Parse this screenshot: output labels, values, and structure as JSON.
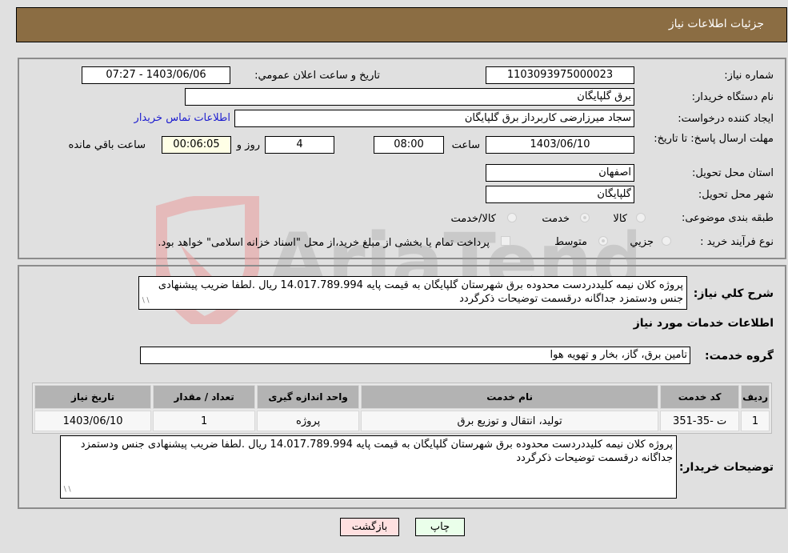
{
  "header": {
    "title": "جزئیات اطلاعات نیاز"
  },
  "form": {
    "need_number": {
      "label": "شماره نیاز:",
      "value": "1103093975000023"
    },
    "announce_datetime": {
      "label": "تاریخ و ساعت اعلان عمومي:",
      "value": "1403/06/06 - 07:27"
    },
    "buyer_org": {
      "label": "نام دستگاه خریدار:",
      "value": "برق گلپایگان"
    },
    "requester": {
      "label": "ایجاد کننده درخواست:",
      "value": "سجاد میرزارضی کاربرداز برق گلپایگان"
    },
    "buyer_contact_link": "اطلاعات تماس خریدار",
    "deadline": {
      "label": "مهلت ارسال پاسخ: تا تاریخ:",
      "date": "1403/06/10",
      "time_label": "ساعت",
      "time": "08:00",
      "days": "4",
      "days_label": "روز و",
      "remaining": "00:06:05",
      "remaining_label": "ساعت باقي مانده"
    },
    "province": {
      "label": "استان محل تحویل:",
      "value": "اصفهان"
    },
    "city": {
      "label": "شهر محل تحویل:",
      "value": "گلپایگان"
    },
    "category": {
      "label": "طبقه بندی موضوعی:",
      "options": [
        "کالا",
        "خدمت",
        "کالا/خدمت"
      ],
      "selected": "خدمت"
    },
    "purchase_type": {
      "label": "نوع فرآیند خرید :",
      "options": [
        "جزيي",
        "متوسط"
      ],
      "selected": "متوسط",
      "treasury_note": "پرداخت تمام یا بخشی از مبلغ خرید،از محل \"اسناد خزانه اسلامی\" خواهد بود."
    }
  },
  "details": {
    "general_desc_label": "شرح کلي نیاز:",
    "general_desc": "پروژه کلان نیمه کلیددردست محدوده برق شهرستان گلپایگان به قیمت پایه 14.017.789.994 ریال .لطفا ضریب پیشنهادی جنس ودستمزد جداگانه درقسمت توضیحات ذکرگردد",
    "services_heading": "اطلاعات خدمات مورد نیاز",
    "service_group_label": "گروه خدمت:",
    "service_group": "تامین برق، گاز، بخار و تهویه هوا",
    "table": {
      "headers": [
        "ردیف",
        "کد خدمت",
        "نام خدمت",
        "واحد اندازه گیری",
        "تعداد / مقدار",
        "تاریخ نیاز"
      ],
      "rows": [
        [
          "1",
          "ت -35-351",
          "تولید، انتقال و توزیع برق",
          "پروژه",
          "1",
          "1403/06/10"
        ]
      ]
    },
    "buyer_notes_label": "توضیحات خریدار:",
    "buyer_notes": "پروژه کلان نیمه کلیددردست محدوده برق شهرستان گلپایگان به قیمت پایه 14.017.789.994 ریال .لطفا ضریب پیشنهادی جنس ودستمزد جداگانه درقسمت توضیحات ذکرگردد"
  },
  "buttons": {
    "print": "چاپ",
    "back": "بازگشت"
  },
  "watermark": {
    "text": "AriaTender.neT"
  },
  "colors": {
    "header_bg": "#8b6d43",
    "print_bg": "#eaffea",
    "back_bg": "#ffe0e0",
    "link": "#1c1ccf"
  }
}
